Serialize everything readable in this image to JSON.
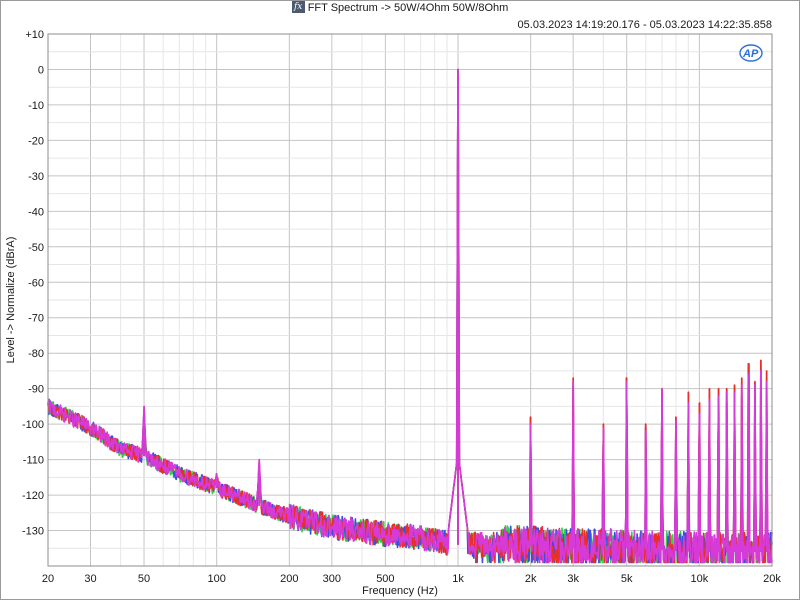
{
  "window": {
    "title": "FFT Spectrum -> 50W/4Ohm 50W/8Ohm",
    "timestamp": "05.03.2023 14:19:20.176 - 05.03.2023 14:22:35.858",
    "logo_text": "AP",
    "fx_icon": "fx"
  },
  "colors": {
    "red": "#e8302a",
    "blue": "#3a4fe0",
    "green": "#34d04a",
    "magenta": "#d63ad8",
    "grid_major": "#c4c4c4",
    "grid_minor": "#e6e6e6",
    "logo": "#2d6fd6"
  },
  "chart_data": {
    "type": "line",
    "title": "FFT Spectrum -> 50W/4Ohm 50W/8Ohm",
    "xlabel": "Frequency (Hz)",
    "ylabel": "Level -> Normalize (dBrA)",
    "xscale": "log",
    "xlim": [
      20,
      20000
    ],
    "ylim": [
      -140,
      10
    ],
    "grid": true,
    "y_ticks": [
      10,
      0,
      -10,
      -20,
      -30,
      -40,
      -50,
      -60,
      -70,
      -80,
      -90,
      -100,
      -110,
      -120,
      -130
    ],
    "y_tick_labels": [
      "+10",
      "0",
      "-10",
      "-20",
      "-30",
      "-40",
      "-50",
      "-60",
      "-70",
      "-80",
      "-90",
      "-100",
      "-110",
      "-120",
      "-130"
    ],
    "x_ticks": [
      20,
      30,
      50,
      100,
      200,
      300,
      500,
      1000,
      2000,
      3000,
      5000,
      10000,
      20000
    ],
    "x_tick_labels": [
      "20",
      "30",
      "50",
      "100",
      "200",
      "300",
      "500",
      "1k",
      "2k",
      "3k",
      "5k",
      "10k",
      "20k"
    ],
    "noise_floor_profile": {
      "x": [
        20,
        30,
        40,
        50,
        70,
        100,
        150,
        200,
        300,
        500,
        700,
        1000,
        2000,
        3000,
        5000,
        10000,
        20000
      ],
      "y": [
        -95,
        -101,
        -107,
        -109,
        -114,
        -118,
        -123,
        -126,
        -129,
        -131,
        -132,
        -134,
        -134,
        -135,
        -135,
        -136,
        -136
      ]
    },
    "series": [
      {
        "color": "red",
        "peaks": [
          {
            "x": 50,
            "y": -96
          },
          {
            "x": 100,
            "y": -114
          },
          {
            "x": 150,
            "y": -111
          },
          {
            "x": 1000,
            "y": 0
          },
          {
            "x": 2000,
            "y": -98
          },
          {
            "x": 3000,
            "y": -87
          },
          {
            "x": 4000,
            "y": -100
          },
          {
            "x": 5000,
            "y": -87
          },
          {
            "x": 6000,
            "y": -100
          },
          {
            "x": 7000,
            "y": -90
          },
          {
            "x": 8000,
            "y": -98
          },
          {
            "x": 9000,
            "y": -91
          },
          {
            "x": 10000,
            "y": -94
          },
          {
            "x": 11000,
            "y": -90
          },
          {
            "x": 12000,
            "y": -90
          },
          {
            "x": 13000,
            "y": -90
          },
          {
            "x": 14000,
            "y": -89
          },
          {
            "x": 15000,
            "y": -87
          },
          {
            "x": 16000,
            "y": -83
          },
          {
            "x": 17000,
            "y": -88
          },
          {
            "x": 18000,
            "y": -82
          },
          {
            "x": 19000,
            "y": -85
          }
        ]
      },
      {
        "color": "blue",
        "peaks": [
          {
            "x": 50,
            "y": -96
          },
          {
            "x": 100,
            "y": -115
          },
          {
            "x": 150,
            "y": -112
          },
          {
            "x": 1000,
            "y": 0
          },
          {
            "x": 2000,
            "y": -100
          },
          {
            "x": 3000,
            "y": -89
          },
          {
            "x": 4000,
            "y": -101
          },
          {
            "x": 5000,
            "y": -87
          },
          {
            "x": 6000,
            "y": -101
          },
          {
            "x": 7000,
            "y": -92
          },
          {
            "x": 8000,
            "y": -100
          },
          {
            "x": 9000,
            "y": -95
          },
          {
            "x": 10000,
            "y": -97
          },
          {
            "x": 11000,
            "y": -95
          },
          {
            "x": 12000,
            "y": -93
          },
          {
            "x": 13000,
            "y": -94
          },
          {
            "x": 14000,
            "y": -93
          },
          {
            "x": 15000,
            "y": -92
          },
          {
            "x": 16000,
            "y": -90
          },
          {
            "x": 17000,
            "y": -92
          },
          {
            "x": 18000,
            "y": -89
          },
          {
            "x": 19000,
            "y": -93
          }
        ]
      },
      {
        "color": "green",
        "peaks": [
          {
            "x": 50,
            "y": -97
          },
          {
            "x": 100,
            "y": -115
          },
          {
            "x": 150,
            "y": -112
          },
          {
            "x": 1000,
            "y": 0
          },
          {
            "x": 2000,
            "y": -108
          },
          {
            "x": 3000,
            "y": -101
          },
          {
            "x": 4000,
            "y": -110
          },
          {
            "x": 5000,
            "y": -101
          },
          {
            "x": 6000,
            "y": -108
          },
          {
            "x": 7000,
            "y": -104
          },
          {
            "x": 8000,
            "y": -107
          },
          {
            "x": 9000,
            "y": -105
          },
          {
            "x": 10000,
            "y": -106
          },
          {
            "x": 11000,
            "y": -107
          },
          {
            "x": 12000,
            "y": -106
          },
          {
            "x": 13000,
            "y": -106
          },
          {
            "x": 14000,
            "y": -106
          },
          {
            "x": 15000,
            "y": -105
          },
          {
            "x": 16000,
            "y": -104
          },
          {
            "x": 17000,
            "y": -105
          },
          {
            "x": 18000,
            "y": -103
          },
          {
            "x": 19000,
            "y": -104
          }
        ]
      },
      {
        "color": "magenta",
        "peaks": [
          {
            "x": 50,
            "y": -95
          },
          {
            "x": 100,
            "y": -114
          },
          {
            "x": 150,
            "y": -110
          },
          {
            "x": 1000,
            "y": 0
          },
          {
            "x": 2000,
            "y": -100
          },
          {
            "x": 3000,
            "y": -88
          },
          {
            "x": 4000,
            "y": -101
          },
          {
            "x": 5000,
            "y": -88
          },
          {
            "x": 6000,
            "y": -102
          },
          {
            "x": 7000,
            "y": -90
          },
          {
            "x": 8000,
            "y": -99
          },
          {
            "x": 9000,
            "y": -94
          },
          {
            "x": 10000,
            "y": -97
          },
          {
            "x": 11000,
            "y": -93
          },
          {
            "x": 12000,
            "y": -92
          },
          {
            "x": 13000,
            "y": -91
          },
          {
            "x": 14000,
            "y": -91
          },
          {
            "x": 15000,
            "y": -89
          },
          {
            "x": 16000,
            "y": -86
          },
          {
            "x": 17000,
            "y": -89
          },
          {
            "x": 18000,
            "y": -85
          },
          {
            "x": 19000,
            "y": -88
          }
        ]
      }
    ]
  }
}
